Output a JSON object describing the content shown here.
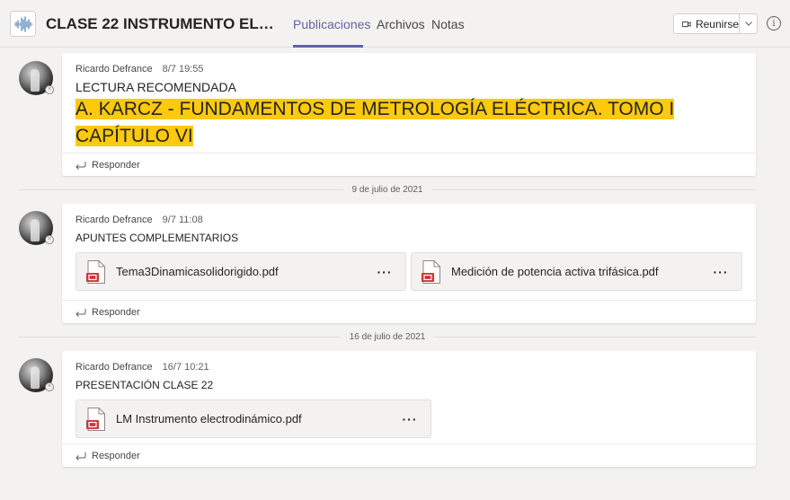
{
  "header": {
    "team_title": "CLASE 22 INSTRUMENTO ELECT...",
    "tabs": [
      {
        "label": "Publicaciones",
        "active": true
      },
      {
        "label": "Archivos",
        "active": false
      },
      {
        "label": "Notas",
        "active": false
      }
    ],
    "meet_label": "Reunirse",
    "info_glyph": "i"
  },
  "colors": {
    "accent": "#6264a7",
    "highlight": "#ffc90e",
    "background": "#f3f2f1",
    "pdf_red": "#d13438"
  },
  "posts": [
    {
      "author": "Ricardo Defrance",
      "time": "8/7 19:55",
      "subject": "LECTURA RECOMENDADA",
      "highlight_text": "A. KARCZ - FUNDAMENTOS DE METROLOGÍA ELÉCTRICA. TOMO I CAPÍTULO VI",
      "reply_label": "Responder"
    },
    {
      "author": "Ricardo Defrance",
      "time": "9/7 11:08",
      "subject": "APUNTES COMPLEMENTARIOS",
      "files": [
        {
          "name": "Tema3Dinamicasolidorigido.pdf",
          "icon": "pdf-file-icon",
          "more": "···"
        },
        {
          "name": "Medición de potencia activa trifásica.pdf",
          "icon": "pdf-file-icon",
          "more": "···"
        }
      ],
      "reply_label": "Responder"
    },
    {
      "author": "Ricardo Defrance",
      "time": "16/7 10:21",
      "subject": "PRESENTACIÓN CLASE 22",
      "files": [
        {
          "name": "LM Instrumento electrodinámico.pdf",
          "icon": "pdf-file-icon",
          "more": "···"
        }
      ],
      "reply_label": "Responder"
    }
  ],
  "date_separators": [
    "9 de julio de 2021",
    "16 de julio de 2021"
  ]
}
